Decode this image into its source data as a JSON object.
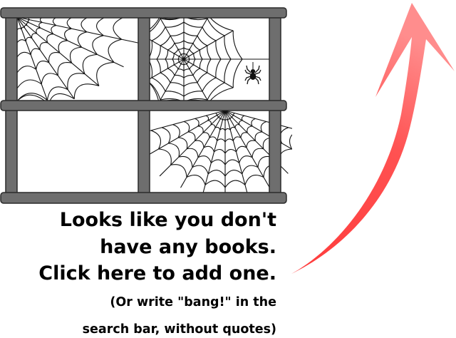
{
  "empty_state": {
    "line_1": "Looks like you don't",
    "line_2": "have any books.",
    "line_3": "Click here to add one.",
    "hint_line_1": "(Or write \"bang!\" in the",
    "hint_line_2": "search bar, without quotes)"
  },
  "illustration": {
    "name": "empty-bookshelf-with-cobwebs",
    "spider_icon": "spider-icon"
  },
  "arrow": {
    "icon": "curved-arrow-up-icon",
    "color": "#ff4a4a",
    "color_light": "#ff8a8a"
  },
  "shelf_colors": {
    "frame": "#6e6e6e",
    "outline": "#2a2a2a",
    "web": "#111111"
  }
}
